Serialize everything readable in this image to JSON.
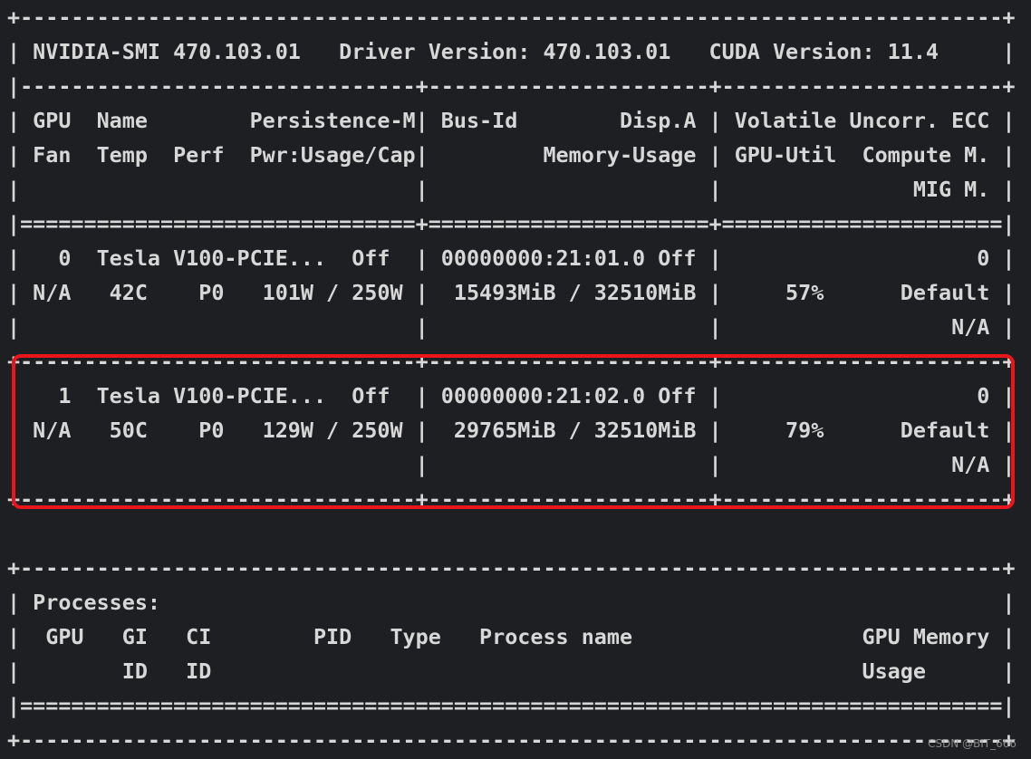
{
  "gpu_table": {
    "top_border": "+-----------------------------------------------------------------------------+",
    "header": "| NVIDIA-SMI 470.103.01   Driver Version: 470.103.01   CUDA Version: 11.4     |",
    "separator_1": "|-------------------------------+----------------------+----------------------+",
    "col_header_1": "| GPU  Name        Persistence-M| Bus-Id        Disp.A | Volatile Uncorr. ECC |",
    "col_header_2": "| Fan  Temp  Perf  Pwr:Usage/Cap|         Memory-Usage | GPU-Util  Compute M. |",
    "col_header_3": "|                               |                      |               MIG M. |",
    "double_separator": "|===============================+======================+======================|",
    "gpus": [
      {
        "line_1": "|   0  Tesla V100-PCIE...  Off  | 00000000:21:01.0 Off |                    0 |",
        "line_2": "| N/A   42C    P0   101W / 250W |  15493MiB / 32510MiB |     57%      Default |",
        "line_3": "|                               |                      |                  N/A |"
      },
      {
        "line_1": "|   1  Tesla V100-PCIE...  Off  | 00000000:21:02.0 Off |                    0 |",
        "line_2": "| N/A   50C    P0   129W / 250W |  29765MiB / 32510MiB |     79%      Default |",
        "line_3": "|                               |                      |                  N/A |"
      }
    ],
    "gpu_separator": "+-------------------------------+----------------------+----------------------+"
  },
  "processes_table": {
    "top_border": "+-----------------------------------------------------------------------------+",
    "title": "| Processes:                                                                  |",
    "header_1": "|  GPU   GI   CI        PID   Type   Process name                  GPU Memory |",
    "header_2": "|        ID   ID                                                   Usage      |",
    "double_separator": "|=============================================================================|",
    "bottom_border": "+-----------------------------------------------------------------------------+"
  },
  "highlight_color": "#e8151b",
  "watermark": "CSDN @BIT_666"
}
